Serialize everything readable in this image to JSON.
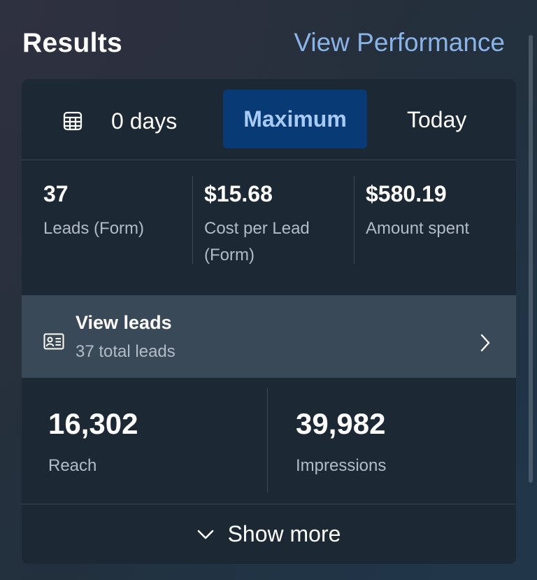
{
  "header": {
    "title": "Results",
    "link": "View Performance"
  },
  "date_range": {
    "days_label": "0 days",
    "options": [
      "Maximum",
      "Today"
    ],
    "selected": "Maximum"
  },
  "metrics": [
    {
      "value": "37",
      "label": "Leads (Form)"
    },
    {
      "value": "$15.68",
      "label_line1": "Cost per Lead",
      "label_line2": "(Form)"
    },
    {
      "value": "$580.19",
      "label": "Amount spent"
    }
  ],
  "view_leads": {
    "title": "View leads",
    "subtitle": "37 total leads"
  },
  "stats": [
    {
      "value": "16,302",
      "label": "Reach"
    },
    {
      "value": "39,982",
      "label": "Impressions"
    }
  ],
  "show_more": "Show more",
  "icons": [
    "calendar-icon",
    "lead-card-icon",
    "chevron-right-icon",
    "chevron-down-icon"
  ],
  "colors": {
    "accent_link": "#8ab4e8",
    "selected_bg": "#083a75",
    "selected_text": "#a7cbf5",
    "card_bg": "#1c2833",
    "view_leads_bg": "#3a4957"
  }
}
